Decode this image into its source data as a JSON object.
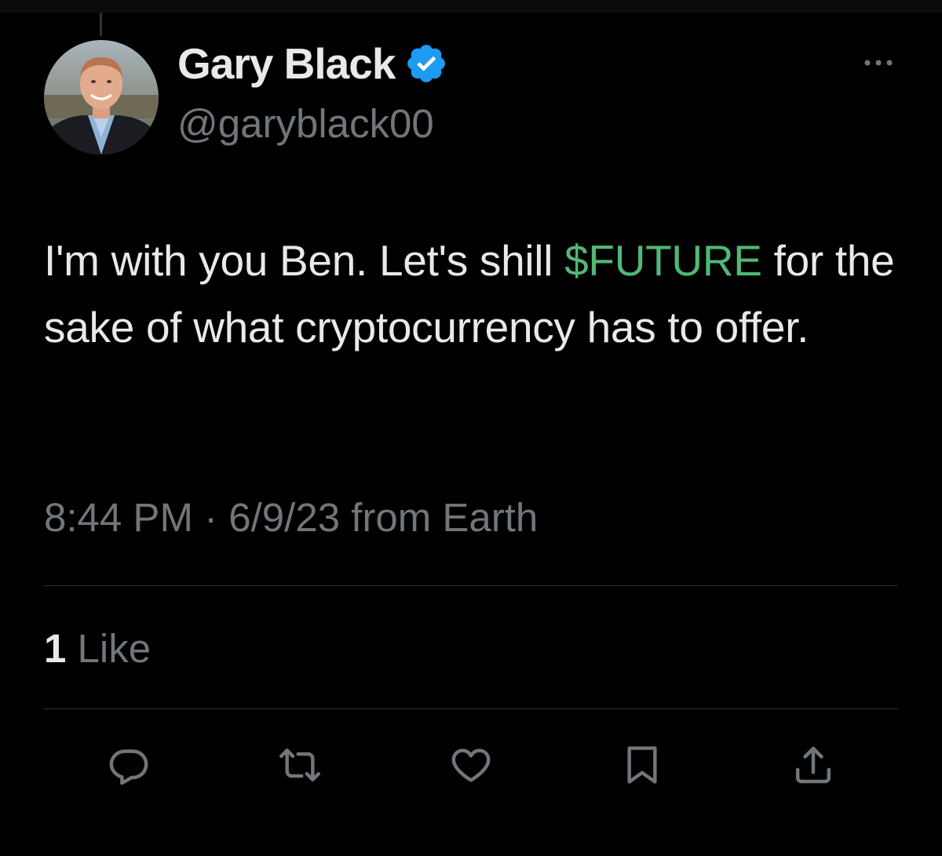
{
  "author": {
    "display_name": "Gary Black",
    "handle": "@garyblack00",
    "verified": true,
    "verified_color": "#1d9bf0"
  },
  "tweet": {
    "text_before": "I'm with you Ben. Let's shill ",
    "cashtag": "$FUTURE",
    "text_after": " for the sake of what cryptocurrency has to offer.",
    "time": "8:44 PM",
    "separator": "·",
    "date": "6/9/23",
    "source": "from Earth"
  },
  "engagement": {
    "likes_count": "1",
    "likes_label": "Like"
  },
  "actions": [
    {
      "name": "reply-button",
      "icon": "reply-icon"
    },
    {
      "name": "retweet-button",
      "icon": "retweet-icon"
    },
    {
      "name": "like-button",
      "icon": "heart-icon"
    },
    {
      "name": "bookmark-button",
      "icon": "bookmark-icon"
    },
    {
      "name": "share-button",
      "icon": "share-icon"
    }
  ],
  "colors": {
    "background": "#000000",
    "text": "#e7e9ea",
    "secondary_text": "#71767b",
    "cashtag": "#52b776",
    "divider": "#2f3336"
  }
}
